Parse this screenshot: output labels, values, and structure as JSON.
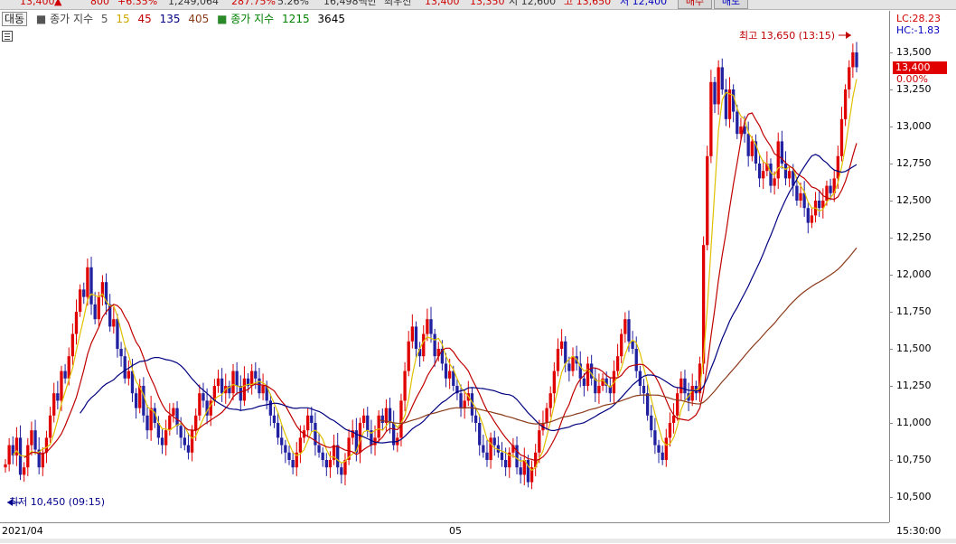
{
  "topbar": {
    "price": "13,400",
    "change": "800",
    "change_pct": "+6.35%",
    "volume": "1,249,064",
    "volume_pct": "287.75%",
    "turnover": "5.26%",
    "amount": "16,498백만",
    "last_label": "최우선",
    "ask": "13,400",
    "bid": "13,350",
    "open": "시 12,600",
    "high": "고 13,650",
    "low": "저 12,400",
    "buy_button": "매수",
    "sell_button": "매도"
  },
  "legend": {
    "chart_type": "대동",
    "ma_title": "종가 지수",
    "ma": [
      {
        "label": "5",
        "color": "#777777"
      },
      {
        "label": "15",
        "color": "#e0c000"
      },
      {
        "label": "45",
        "color": "#c00000"
      },
      {
        "label": "135",
        "color": "#000080"
      },
      {
        "label": "405",
        "color": "#8b3a1a"
      }
    ],
    "ma2_title": "종가 지수",
    "ma2": [
      {
        "label": "1215",
        "color": "#008000"
      },
      {
        "label": "3645",
        "color": "#000000"
      }
    ]
  },
  "right_axis": {
    "lc": "LC:28.23",
    "hc": "HC:-1.83",
    "current_price": "13,400",
    "current_pct": "0.00%",
    "time": "15:30:00"
  },
  "annotations": {
    "high": "최고 13,650 (13:15)",
    "low": "최저 10,450 (09:15)"
  },
  "chart_data": {
    "type": "candlestick",
    "x_labels": [
      "2021/04",
      "05"
    ],
    "y_ticks": [
      10500,
      10750,
      11000,
      11250,
      11500,
      11750,
      12000,
      12250,
      12500,
      12750,
      13000,
      13250,
      13500
    ],
    "ylim": [
      10350,
      13750
    ],
    "grid": false,
    "legend_placement": "top-left",
    "colors": {
      "up": "#e00000",
      "down": "#2020a0",
      "ma5": "#777777",
      "ma15": "#e0c000",
      "ma45": "#c00000",
      "ma135": "#000080",
      "ma405": "#8b3a1a"
    },
    "close": [
      10720,
      10850,
      10780,
      10900,
      10650,
      10700,
      10850,
      10950,
      10820,
      10700,
      10800,
      10900,
      11050,
      11200,
      11150,
      11350,
      11300,
      11450,
      11600,
      11750,
      11900,
      11850,
      12050,
      11800,
      11700,
      11850,
      11950,
      11800,
      11650,
      11700,
      11500,
      11450,
      11300,
      11350,
      11200,
      11100,
      11250,
      11050,
      10950,
      11100,
      11000,
      10900,
      10850,
      10950,
      11050,
      11100,
      10980,
      10900,
      10850,
      10800,
      10950,
      11050,
      11200,
      11150,
      11050,
      11150,
      11250,
      11300,
      11200,
      11250,
      11200,
      11350,
      11250,
      11150,
      11300,
      11250,
      11350,
      11300,
      11200,
      11250,
      11150,
      11050,
      11000,
      10900,
      10850,
      10800,
      10750,
      10700,
      10800,
      10900,
      10950,
      11050,
      11000,
      10850,
      10800,
      10750,
      10700,
      10750,
      10850,
      10700,
      10650,
      10750,
      10900,
      10950,
      10800,
      11000,
      11050,
      10950,
      10850,
      10900,
      11050,
      11000,
      11100,
      11000,
      10850,
      10900,
      11150,
      11350,
      11550,
      11650,
      11500,
      11450,
      11600,
      11700,
      11600,
      11450,
      11500,
      11400,
      11300,
      11350,
      11250,
      11200,
      11100,
      11150,
      11200,
      11050,
      11000,
      10850,
      10800,
      10750,
      10900,
      10850,
      10800,
      10750,
      10700,
      10800,
      10850,
      10700,
      10650,
      10750,
      10600,
      10700,
      10800,
      10950,
      11000,
      11100,
      11200,
      11350,
      11500,
      11550,
      11400,
      11350,
      11450,
      11400,
      11300,
      11250,
      11400,
      11300,
      11200,
      11250,
      11300,
      11250,
      11200,
      11350,
      11450,
      11600,
      11700,
      11550,
      11500,
      11350,
      11250,
      11200,
      11050,
      10950,
      10850,
      10800,
      10750,
      10900,
      11000,
      11050,
      11200,
      11300,
      11200,
      11150,
      11250,
      11200,
      11400,
      12200,
      12800,
      13300,
      13150,
      13400,
      13250,
      13050,
      13250,
      13100,
      12950,
      13000,
      12950,
      12800,
      12900,
      12750,
      12650,
      12700,
      12750,
      12600,
      12650,
      12900,
      12750,
      12650,
      12700,
      12600,
      12500,
      12550,
      12450,
      12350,
      12400,
      12500,
      12450,
      12500,
      12600,
      12550,
      12650,
      12800,
      13050,
      13250,
      13400,
      13500,
      13400
    ]
  }
}
